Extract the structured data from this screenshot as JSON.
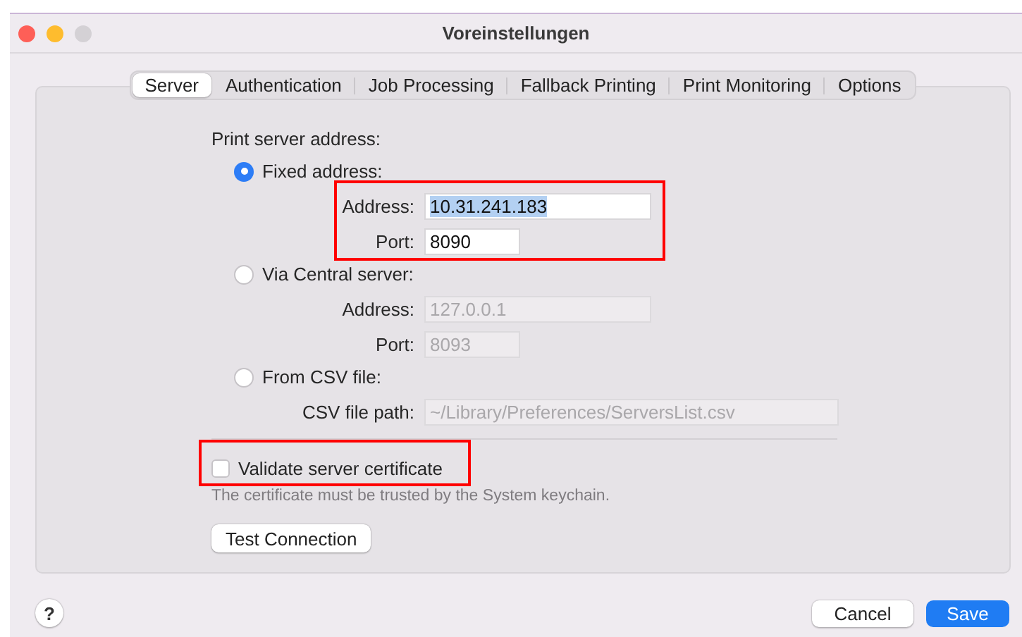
{
  "window": {
    "title": "Voreinstellungen"
  },
  "tabs": [
    {
      "label": "Server",
      "selected": true
    },
    {
      "label": "Authentication",
      "selected": false
    },
    {
      "label": "Job Processing",
      "selected": false
    },
    {
      "label": "Fallback Printing",
      "selected": false
    },
    {
      "label": "Print Monitoring",
      "selected": false
    },
    {
      "label": "Options",
      "selected": false
    }
  ],
  "section_label": "Print server address:",
  "options": [
    {
      "label": "Fixed address:",
      "selected": true,
      "highlighted": true,
      "fields": [
        {
          "label": "Address:",
          "value": "10.31.241.183",
          "kind": "address",
          "disabled": false,
          "text_selected": true
        },
        {
          "label": "Port:",
          "value": "8090",
          "kind": "port",
          "disabled": false,
          "text_selected": false
        }
      ]
    },
    {
      "label": "Via Central server:",
      "selected": false,
      "highlighted": false,
      "fields": [
        {
          "label": "Address:",
          "value": "127.0.0.1",
          "kind": "address",
          "disabled": true,
          "text_selected": false
        },
        {
          "label": "Port:",
          "value": "8093",
          "kind": "port",
          "disabled": true,
          "text_selected": false
        }
      ]
    },
    {
      "label": "From CSV file:",
      "selected": false,
      "highlighted": false,
      "fields": [
        {
          "label": "CSV file path:",
          "value": "~/Library/Preferences/ServersList.csv",
          "kind": "path",
          "disabled": true,
          "text_selected": false
        }
      ]
    }
  ],
  "certificate": {
    "label": "Validate server certificate",
    "checked": false,
    "highlighted": true,
    "note": "The certificate must be trusted by the System keychain."
  },
  "test_button": "Test Connection",
  "help_button": "?",
  "buttons": [
    {
      "label": "Cancel",
      "kind": "secondary"
    },
    {
      "label": "Save",
      "kind": "primary"
    }
  ]
}
